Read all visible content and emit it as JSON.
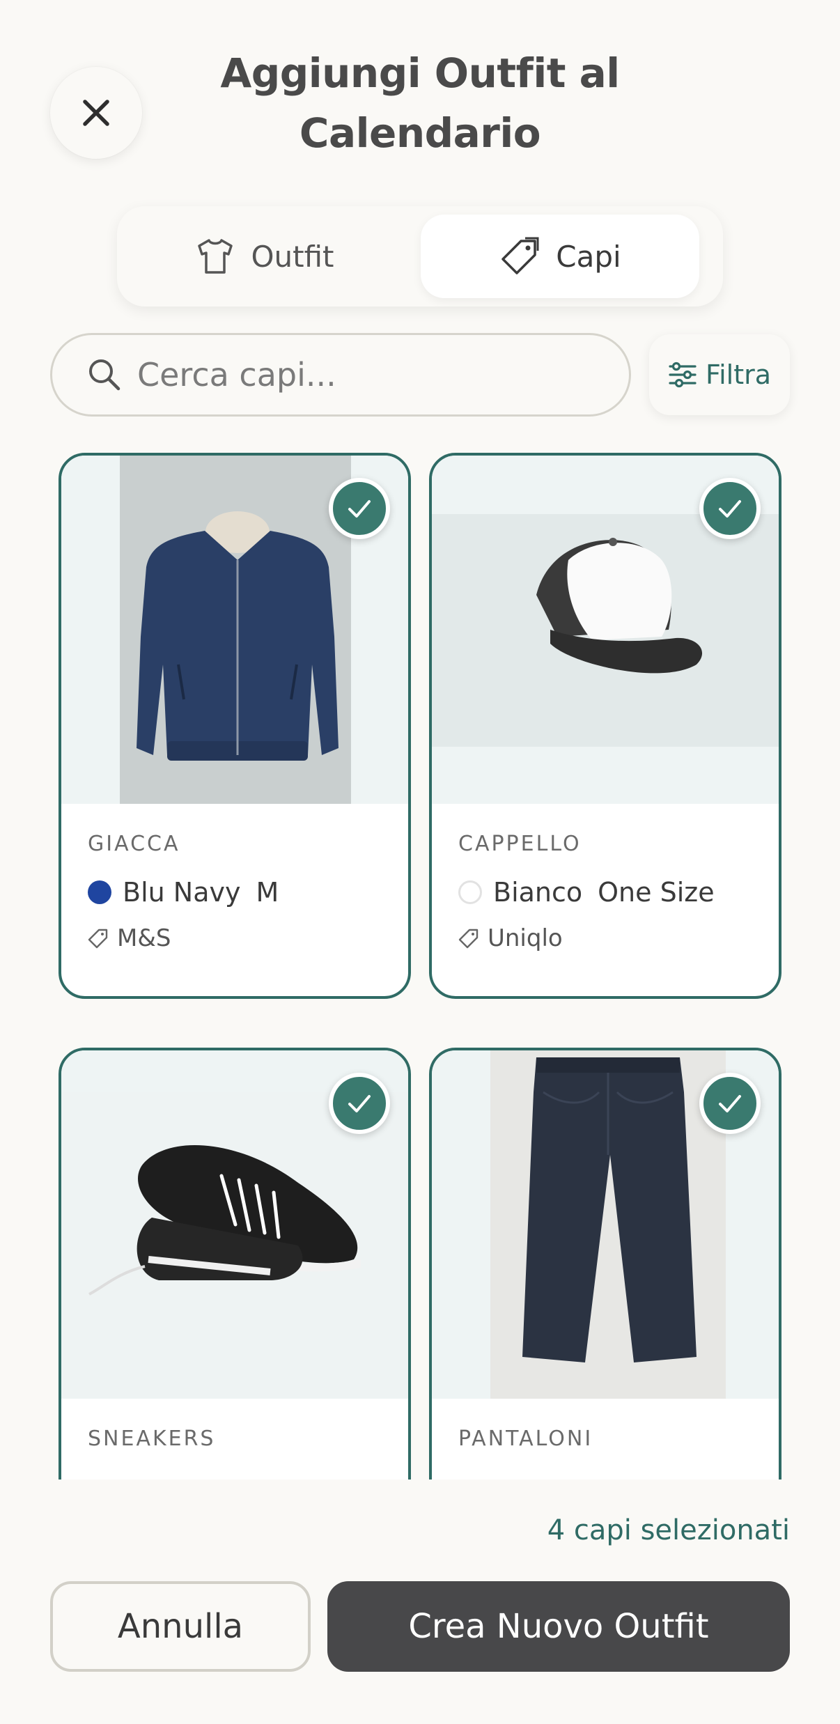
{
  "header": {
    "title_line1": "Aggiungi Outfit al",
    "title_line2": "Calendario",
    "close_icon": "close-icon"
  },
  "tabs": [
    {
      "label": "Outfit",
      "icon": "shirt-icon",
      "active": false
    },
    {
      "label": "Capi",
      "icon": "tag-icon",
      "active": true
    }
  ],
  "search": {
    "placeholder": "Cerca capi...",
    "value": ""
  },
  "filter": {
    "label": "Filtra",
    "icon": "sliders-icon"
  },
  "items": [
    {
      "category": "GIACCA",
      "color_name": "Blu Navy",
      "color_hex": "#1f45a0",
      "size": "M",
      "brand": "M&S",
      "selected": true,
      "image": "navy-jacket"
    },
    {
      "category": "CAPPELLO",
      "color_name": "Bianco",
      "color_hex": "#ffffff",
      "size": "One Size",
      "brand": "Uniqlo",
      "selected": true,
      "image": "trucker-cap"
    },
    {
      "category": "SNEAKERS",
      "selected": true,
      "image": "black-sneakers"
    },
    {
      "category": "PANTALONI",
      "selected": true,
      "image": "dark-jeans"
    }
  ],
  "footer": {
    "selected_count": "4 capi selezionati",
    "cancel_label": "Annulla",
    "create_label": "Crea Nuovo Outfit"
  },
  "colors": {
    "accent": "#2f6b65",
    "check": "#3a7a6f",
    "primary_button": "#48484a",
    "background": "#faf9f6"
  }
}
